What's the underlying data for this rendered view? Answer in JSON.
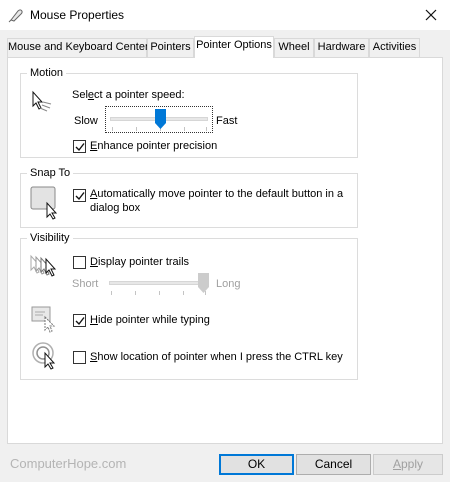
{
  "window": {
    "title": "Mouse Properties",
    "close_icon": "close-icon"
  },
  "tabs": [
    {
      "label": "Mouse and Keyboard Center",
      "active": false
    },
    {
      "label": "Pointers",
      "active": false
    },
    {
      "label": "Pointer Options",
      "active": true
    },
    {
      "label": "Wheel",
      "active": false
    },
    {
      "label": "Hardware",
      "active": false
    },
    {
      "label": "Activities",
      "active": false
    }
  ],
  "motion": {
    "group_label": "Motion",
    "speed_label": "Select a pointer speed:",
    "slow_label": "Slow",
    "fast_label": "Fast",
    "speed_level": 0.5,
    "enhance_label": "Enhance pointer precision",
    "enhance_checked": true
  },
  "snap_to": {
    "group_label": "Snap To",
    "line1": "Automatically move pointer to the default button in a",
    "line2": "dialog box",
    "checked": true
  },
  "visibility": {
    "group_label": "Visibility",
    "trails_label": "Display pointer trails",
    "trails_checked": false,
    "short_label": "Short",
    "long_label": "Long",
    "trails_level": 1.0,
    "hide_label": "Hide pointer while typing",
    "hide_checked": true,
    "show_location_label": "Show location of pointer when I press the CTRL key",
    "show_location_checked": false
  },
  "buttons": {
    "ok": "OK",
    "cancel": "Cancel",
    "apply": "Apply"
  },
  "watermark": "ComputerHope.com",
  "colors": {
    "accent": "#0078d7",
    "disabled_text": "#a0a0a0"
  }
}
